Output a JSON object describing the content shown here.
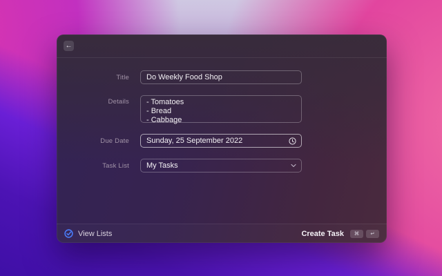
{
  "window": {
    "header": {
      "back_icon": "←"
    },
    "form": {
      "fields": [
        {
          "label": "Title",
          "value": "Do Weekly Food Shop"
        },
        {
          "label": "Details",
          "value": "- Tomatoes\n- Bread\n- Cabbage"
        },
        {
          "label": "Due Date",
          "value": "Sunday, 25 September 2022"
        },
        {
          "label": "Task List",
          "value": "My Tasks"
        }
      ]
    },
    "footer": {
      "view_lists_label": "View Lists",
      "create_task_label": "Create Task",
      "shortcut_keys": [
        "⌘",
        "↵"
      ]
    }
  },
  "colors": {
    "accent_blue": "#4a7bf8",
    "window_tint_top": "#3b2f3d",
    "window_tint_bottom_left": "#2e2150",
    "wallpaper_pink": "#e2459f",
    "wallpaper_violet": "#5a1bc5"
  }
}
